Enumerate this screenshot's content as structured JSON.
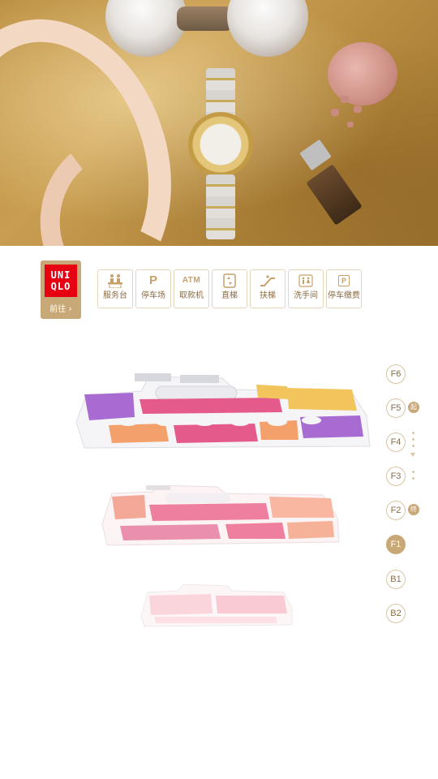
{
  "store": {
    "logo_line1": "UNI",
    "logo_line2": "QLO",
    "goto_label": "前往",
    "goto_arrow": "›"
  },
  "facilities": [
    {
      "icon": "service-desk-icon",
      "label": "服务台"
    },
    {
      "icon": "parking-icon",
      "label": "停车场",
      "glyph": "P"
    },
    {
      "icon": "atm-icon",
      "label": "取款机",
      "glyph": "ATM"
    },
    {
      "icon": "elevator-icon",
      "label": "直梯"
    },
    {
      "icon": "escalator-icon",
      "label": "扶梯"
    },
    {
      "icon": "restroom-icon",
      "label": "洗手间"
    },
    {
      "icon": "parking-payment-icon",
      "label": "停车缴费",
      "glyph": "P"
    }
  ],
  "floors": [
    "F6",
    "F5",
    "F4",
    "F3",
    "F2",
    "F1",
    "B1",
    "B2"
  ],
  "active_floor": "F1",
  "floor_markers": {
    "F5": "起",
    "F2": "终"
  },
  "colors": {
    "accent": "#c9a877",
    "uniqlo_red": "#e60012",
    "map_purple": "#a86bd1",
    "map_pink": "#e45a8a",
    "map_orange": "#f3a06a",
    "map_yellow": "#f2c45c"
  }
}
